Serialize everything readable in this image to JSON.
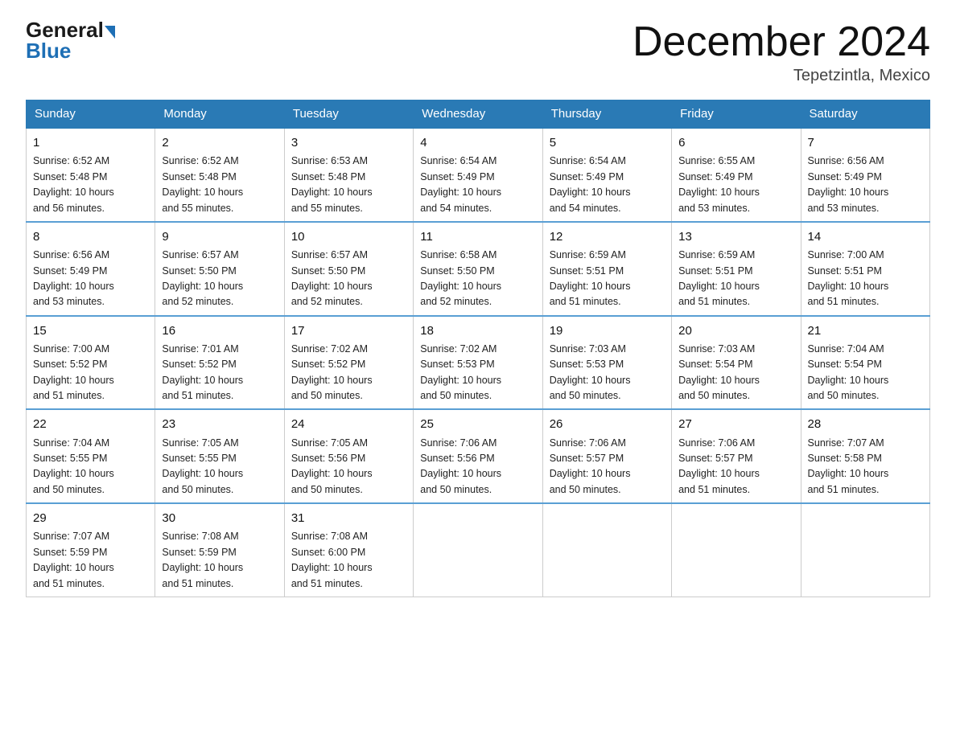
{
  "header": {
    "logo_general": "General",
    "logo_blue": "Blue",
    "month_title": "December 2024",
    "location": "Tepetzintla, Mexico"
  },
  "days_of_week": [
    "Sunday",
    "Monday",
    "Tuesday",
    "Wednesday",
    "Thursday",
    "Friday",
    "Saturday"
  ],
  "weeks": [
    [
      {
        "day": "1",
        "sunrise": "6:52 AM",
        "sunset": "5:48 PM",
        "daylight": "10 hours and 56 minutes."
      },
      {
        "day": "2",
        "sunrise": "6:52 AM",
        "sunset": "5:48 PM",
        "daylight": "10 hours and 55 minutes."
      },
      {
        "day": "3",
        "sunrise": "6:53 AM",
        "sunset": "5:48 PM",
        "daylight": "10 hours and 55 minutes."
      },
      {
        "day": "4",
        "sunrise": "6:54 AM",
        "sunset": "5:49 PM",
        "daylight": "10 hours and 54 minutes."
      },
      {
        "day": "5",
        "sunrise": "6:54 AM",
        "sunset": "5:49 PM",
        "daylight": "10 hours and 54 minutes."
      },
      {
        "day": "6",
        "sunrise": "6:55 AM",
        "sunset": "5:49 PM",
        "daylight": "10 hours and 53 minutes."
      },
      {
        "day": "7",
        "sunrise": "6:56 AM",
        "sunset": "5:49 PM",
        "daylight": "10 hours and 53 minutes."
      }
    ],
    [
      {
        "day": "8",
        "sunrise": "6:56 AM",
        "sunset": "5:49 PM",
        "daylight": "10 hours and 53 minutes."
      },
      {
        "day": "9",
        "sunrise": "6:57 AM",
        "sunset": "5:50 PM",
        "daylight": "10 hours and 52 minutes."
      },
      {
        "day": "10",
        "sunrise": "6:57 AM",
        "sunset": "5:50 PM",
        "daylight": "10 hours and 52 minutes."
      },
      {
        "day": "11",
        "sunrise": "6:58 AM",
        "sunset": "5:50 PM",
        "daylight": "10 hours and 52 minutes."
      },
      {
        "day": "12",
        "sunrise": "6:59 AM",
        "sunset": "5:51 PM",
        "daylight": "10 hours and 51 minutes."
      },
      {
        "day": "13",
        "sunrise": "6:59 AM",
        "sunset": "5:51 PM",
        "daylight": "10 hours and 51 minutes."
      },
      {
        "day": "14",
        "sunrise": "7:00 AM",
        "sunset": "5:51 PM",
        "daylight": "10 hours and 51 minutes."
      }
    ],
    [
      {
        "day": "15",
        "sunrise": "7:00 AM",
        "sunset": "5:52 PM",
        "daylight": "10 hours and 51 minutes."
      },
      {
        "day": "16",
        "sunrise": "7:01 AM",
        "sunset": "5:52 PM",
        "daylight": "10 hours and 51 minutes."
      },
      {
        "day": "17",
        "sunrise": "7:02 AM",
        "sunset": "5:52 PM",
        "daylight": "10 hours and 50 minutes."
      },
      {
        "day": "18",
        "sunrise": "7:02 AM",
        "sunset": "5:53 PM",
        "daylight": "10 hours and 50 minutes."
      },
      {
        "day": "19",
        "sunrise": "7:03 AM",
        "sunset": "5:53 PM",
        "daylight": "10 hours and 50 minutes."
      },
      {
        "day": "20",
        "sunrise": "7:03 AM",
        "sunset": "5:54 PM",
        "daylight": "10 hours and 50 minutes."
      },
      {
        "day": "21",
        "sunrise": "7:04 AM",
        "sunset": "5:54 PM",
        "daylight": "10 hours and 50 minutes."
      }
    ],
    [
      {
        "day": "22",
        "sunrise": "7:04 AM",
        "sunset": "5:55 PM",
        "daylight": "10 hours and 50 minutes."
      },
      {
        "day": "23",
        "sunrise": "7:05 AM",
        "sunset": "5:55 PM",
        "daylight": "10 hours and 50 minutes."
      },
      {
        "day": "24",
        "sunrise": "7:05 AM",
        "sunset": "5:56 PM",
        "daylight": "10 hours and 50 minutes."
      },
      {
        "day": "25",
        "sunrise": "7:06 AM",
        "sunset": "5:56 PM",
        "daylight": "10 hours and 50 minutes."
      },
      {
        "day": "26",
        "sunrise": "7:06 AM",
        "sunset": "5:57 PM",
        "daylight": "10 hours and 50 minutes."
      },
      {
        "day": "27",
        "sunrise": "7:06 AM",
        "sunset": "5:57 PM",
        "daylight": "10 hours and 51 minutes."
      },
      {
        "day": "28",
        "sunrise": "7:07 AM",
        "sunset": "5:58 PM",
        "daylight": "10 hours and 51 minutes."
      }
    ],
    [
      {
        "day": "29",
        "sunrise": "7:07 AM",
        "sunset": "5:59 PM",
        "daylight": "10 hours and 51 minutes."
      },
      {
        "day": "30",
        "sunrise": "7:08 AM",
        "sunset": "5:59 PM",
        "daylight": "10 hours and 51 minutes."
      },
      {
        "day": "31",
        "sunrise": "7:08 AM",
        "sunset": "6:00 PM",
        "daylight": "10 hours and 51 minutes."
      },
      null,
      null,
      null,
      null
    ]
  ],
  "labels": {
    "sunrise": "Sunrise:",
    "sunset": "Sunset:",
    "daylight": "Daylight:"
  }
}
